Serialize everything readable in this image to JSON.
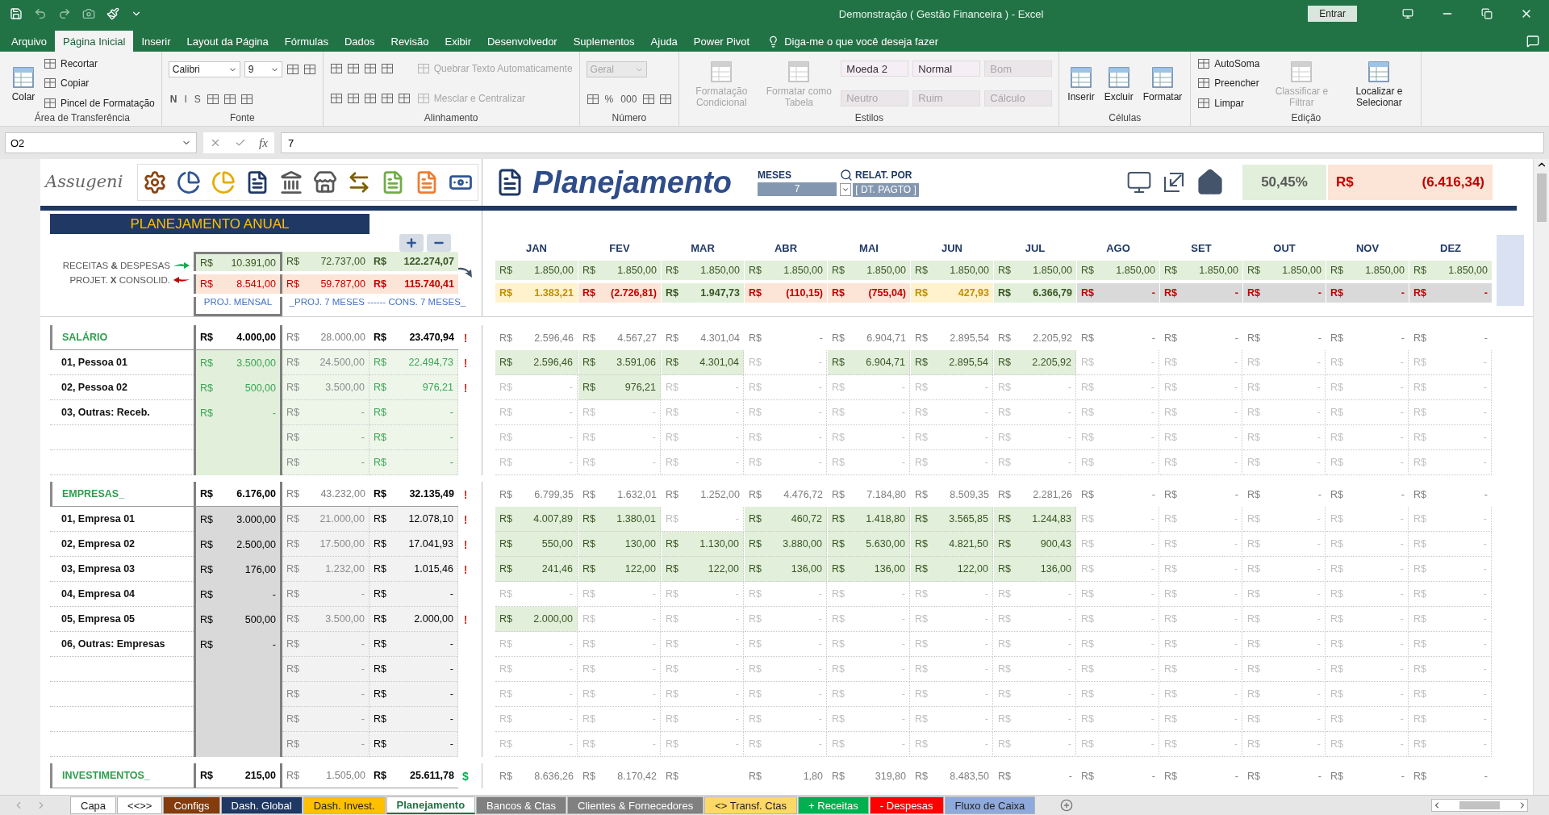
{
  "window": {
    "title": "Demonstração ( Gestão Financeira )  -  Excel",
    "sign_in": "Entrar"
  },
  "ribbon_tabs": [
    {
      "label": "Arquivo",
      "selected": false
    },
    {
      "label": "Página Inicial",
      "selected": true
    },
    {
      "label": "Inserir",
      "selected": false
    },
    {
      "label": "Layout da Página",
      "selected": false
    },
    {
      "label": "Fórmulas",
      "selected": false
    },
    {
      "label": "Dados",
      "selected": false
    },
    {
      "label": "Revisão",
      "selected": false
    },
    {
      "label": "Exibir",
      "selected": false
    },
    {
      "label": "Desenvolvedor",
      "selected": false
    },
    {
      "label": "Suplementos",
      "selected": false
    },
    {
      "label": "Ajuda",
      "selected": false
    },
    {
      "label": "Power Pivot",
      "selected": false
    }
  ],
  "tell_me": "Diga-me o que você deseja fazer",
  "ribbon": [
    {
      "label": "Área de Transferência",
      "columns": [
        [
          [
            {
              "kind": "big",
              "label": "Colar",
              "disabled": false
            }
          ]
        ],
        [
          [
            {
              "kind": "small",
              "label": "Recortar",
              "disabled": false
            }
          ],
          [
            {
              "kind": "small",
              "label": "Copiar",
              "disabled": false
            }
          ],
          [
            {
              "kind": "small",
              "label": "Pincel de Formatação",
              "disabled": false
            }
          ]
        ]
      ]
    },
    {
      "label": "Fonte",
      "columns": [
        [
          [
            {
              "kind": "field",
              "label": "Calibri",
              "disabled": false
            },
            {
              "kind": "field",
              "label": "9",
              "disabled": false
            },
            {
              "kind": "icon"
            },
            {
              "kind": "icon"
            }
          ],
          [
            {
              "kind": "glyph",
              "label": "N",
              "disabled": false
            },
            {
              "kind": "glyph",
              "label": "I",
              "disabled": false
            },
            {
              "kind": "glyph",
              "label": "S",
              "disabled": false
            },
            {
              "kind": "icon"
            },
            {
              "kind": "icon"
            },
            {
              "kind": "icon"
            }
          ]
        ]
      ]
    },
    {
      "label": "Alinhamento",
      "columns": [
        [
          [
            {
              "kind": "icon"
            },
            {
              "kind": "icon"
            },
            {
              "kind": "icon"
            },
            {
              "kind": "icon"
            }
          ],
          [
            {
              "kind": "icon"
            },
            {
              "kind": "icon"
            },
            {
              "kind": "icon"
            },
            {
              "kind": "icon"
            },
            {
              "kind": "icon"
            }
          ]
        ],
        [
          [
            {
              "kind": "small",
              "label": "Quebrar Texto Automaticamente",
              "disabled": true
            }
          ],
          [
            {
              "kind": "small",
              "label": "Mesclar e Centralizar",
              "disabled": true
            }
          ]
        ]
      ]
    },
    {
      "label": "Número",
      "columns": [
        [
          [
            {
              "kind": "field",
              "label": "Geral",
              "disabled": true
            }
          ],
          [
            {
              "kind": "icon"
            },
            {
              "kind": "glyph",
              "label": "%",
              "disabled": false
            },
            {
              "kind": "glyph",
              "label": "000",
              "disabled": false
            },
            {
              "kind": "icon"
            },
            {
              "kind": "icon"
            }
          ]
        ]
      ]
    },
    {
      "label": "Estilos",
      "columns": [
        [
          [
            {
              "kind": "big",
              "label": "Formatação Condicional",
              "disabled": true
            }
          ]
        ],
        [
          [
            {
              "kind": "big",
              "label": "Formatar como Tabela",
              "disabled": true
            }
          ]
        ],
        [
          [
            {
              "kind": "style",
              "label": "Moeda 2",
              "disabled": false
            },
            {
              "kind": "style",
              "label": "Normal",
              "disabled": false
            },
            {
              "kind": "style",
              "label": "Bom",
              "disabled": true
            }
          ],
          [
            {
              "kind": "style",
              "label": "Neutro",
              "disabled": true
            },
            {
              "kind": "style",
              "label": "Ruim",
              "disabled": true
            },
            {
              "kind": "style",
              "label": "Cálculo",
              "disabled": true
            }
          ]
        ]
      ]
    },
    {
      "label": "Células",
      "columns": [
        [
          [
            {
              "kind": "big",
              "label": "Inserir",
              "disabled": false
            }
          ]
        ],
        [
          [
            {
              "kind": "big",
              "label": "Excluir",
              "disabled": false
            }
          ]
        ],
        [
          [
            {
              "kind": "big",
              "label": "Formatar",
              "disabled": false
            }
          ]
        ]
      ]
    },
    {
      "label": "Edição",
      "columns": [
        [
          [
            {
              "kind": "small",
              "label": "AutoSoma",
              "disabled": false
            }
          ],
          [
            {
              "kind": "small",
              "label": "Preencher",
              "disabled": false
            }
          ],
          [
            {
              "kind": "small",
              "label": "Limpar",
              "disabled": false
            }
          ]
        ],
        [
          [
            {
              "kind": "big",
              "label": "Classificar e Filtrar",
              "disabled": true
            }
          ]
        ],
        [
          [
            {
              "kind": "big",
              "label": "Localizar e Selecionar",
              "disabled": false
            }
          ]
        ]
      ]
    }
  ],
  "formula_bar": {
    "name_box": "O2",
    "fx": "fx",
    "value": "7"
  },
  "sheet": {
    "logo": "Assugeni",
    "title": "Planejamento",
    "months_label": "MESES",
    "months_value": "7",
    "report_label": "RELAT. POR",
    "report_value": "[ DT. PAGTO ]",
    "ratio": "50,45%",
    "balance": [
      "R$",
      "(6.416,34)"
    ],
    "banner": "PLANEJAMENTO ANUAL",
    "legend": [
      "RECEITAS **&** DESPESAS",
      "PROJET. **X** CONSOLID."
    ],
    "months": [
      "JAN",
      "FEV",
      "MAR",
      "ABR",
      "MAI",
      "JUN",
      "JUL",
      "AGO",
      "SET",
      "OUT",
      "NOV",
      "DEZ"
    ],
    "summary": [
      {
        "kind": "income",
        "cells": [
          [
            "R$",
            "10.391,00"
          ],
          [
            "R$",
            "72.737,00"
          ],
          [
            "R$",
            "122.274,07"
          ]
        ],
        "months": [
          {
            "text": [
              "R$",
              "1.850,00"
            ],
            "color": "#e2efda"
          },
          {
            "text": [
              "R$",
              "1.850,00"
            ],
            "color": "#e2efda"
          },
          {
            "text": [
              "R$",
              "1.850,00"
            ],
            "color": "#e2efda"
          },
          {
            "text": [
              "R$",
              "1.850,00"
            ],
            "color": "#e2efda"
          },
          {
            "text": [
              "R$",
              "1.850,00"
            ],
            "color": "#e2efda"
          },
          {
            "text": [
              "R$",
              "1.850,00"
            ],
            "color": "#e2efda"
          },
          {
            "text": [
              "R$",
              "1.850,00"
            ],
            "color": "#e2efda"
          },
          {
            "text": [
              "R$",
              "1.850,00"
            ],
            "color": "#e2efda"
          },
          {
            "text": [
              "R$",
              "1.850,00"
            ],
            "color": "#e2efda"
          },
          {
            "text": [
              "R$",
              "1.850,00"
            ],
            "color": "#e2efda"
          },
          {
            "text": [
              "R$",
              "1.850,00"
            ],
            "color": "#e2efda"
          },
          {
            "text": [
              "R$",
              "1.850,00"
            ],
            "color": "#e2efda"
          }
        ]
      },
      {
        "kind": "expense",
        "cells": [
          [
            "R$",
            "8.541,00"
          ],
          [
            "R$",
            "59.787,00"
          ],
          [
            "R$",
            "115.740,41"
          ]
        ],
        "months": [
          {
            "text": [
              "R$",
              "1.383,21"
            ],
            "color": "#fff2cc"
          },
          {
            "text": [
              "R$",
              "(2.726,81)"
            ],
            "color": "#fce4d6"
          },
          {
            "text": [
              "R$",
              "1.947,73"
            ],
            "color": "#e2efda"
          },
          {
            "text": [
              "R$",
              "(110,15)"
            ],
            "color": "#fce4d6"
          },
          {
            "text": [
              "R$",
              "(755,04)"
            ],
            "color": "#fce4d6"
          },
          {
            "text": [
              "R$",
              "427,93"
            ],
            "color": "#fff2cc"
          },
          {
            "text": [
              "R$",
              "6.366,79"
            ],
            "color": "#e2efda"
          },
          {
            "text": [
              "R$",
              "-"
            ],
            "color": "#d9d9d9"
          },
          {
            "text": [
              "R$",
              "-"
            ],
            "color": "#d9d9d9"
          },
          {
            "text": [
              "R$",
              "-"
            ],
            "color": "#d9d9d9"
          },
          {
            "text": [
              "R$",
              "-"
            ],
            "color": "#d9d9d9"
          },
          {
            "text": [
              "R$",
              "-"
            ],
            "color": "#d9d9d9"
          }
        ]
      }
    ],
    "captions": [
      "PROJ. MENSAL",
      "_PROJ. 7 MESES  ------  CONS. 7 MESES_"
    ],
    "rows": [
      {
        "kind": "section",
        "label": "SALÁRIO",
        "cells": [
          [
            "R$",
            "4.000,00"
          ],
          [
            "R$",
            "28.000,00"
          ],
          [
            "R$",
            "23.470,94"
          ]
        ],
        "flag": {
          "text": "!",
          "color": "#c0392b"
        },
        "months": [
          [
            "R$",
            "2.596,46"
          ],
          [
            "R$",
            "4.567,27"
          ],
          [
            "R$",
            "4.301,04"
          ],
          [
            "R$",
            "-"
          ],
          [
            "R$",
            "6.904,71"
          ],
          [
            "R$",
            "2.895,54"
          ],
          [
            "R$",
            "2.205,92"
          ],
          [
            "R$",
            "-"
          ],
          [
            "R$",
            "-"
          ],
          [
            "R$",
            "-"
          ],
          [
            "R$",
            "-"
          ],
          [
            "R$",
            "-"
          ]
        ]
      },
      {
        "kind": "income",
        "label": "01,  Pessoa 01",
        "cells": [
          [
            "R$",
            "3.500,00"
          ],
          [
            "R$",
            "24.500,00"
          ],
          [
            "R$",
            "22.494,73"
          ]
        ],
        "flag": {
          "text": "!",
          "color": "#c0392b"
        },
        "months": [
          [
            "R$",
            "2.596,46"
          ],
          [
            "R$",
            "3.591,06"
          ],
          [
            "R$",
            "4.301,04"
          ],
          [
            "R$",
            "-"
          ],
          [
            "R$",
            "6.904,71"
          ],
          [
            "R$",
            "2.895,54"
          ],
          [
            "R$",
            "2.205,92"
          ],
          [
            "R$",
            "-"
          ],
          [
            "R$",
            "-"
          ],
          [
            "R$",
            "-"
          ],
          [
            "R$",
            "-"
          ],
          [
            "R$",
            "-"
          ]
        ],
        "hl": [
          true,
          true,
          true,
          false,
          true,
          true,
          true,
          false,
          false,
          false,
          false,
          false
        ]
      },
      {
        "kind": "income",
        "label": "02,  Pessoa 02",
        "cells": [
          [
            "R$",
            "500,00"
          ],
          [
            "R$",
            "3.500,00"
          ],
          [
            "R$",
            "976,21"
          ]
        ],
        "flag": {
          "text": "!",
          "color": "#c0392b"
        },
        "months": [
          [
            "R$",
            "-"
          ],
          [
            "R$",
            "976,21"
          ],
          [
            "R$",
            "-"
          ],
          [
            "R$",
            "-"
          ],
          [
            "R$",
            "-"
          ],
          [
            "R$",
            "-"
          ],
          [
            "R$",
            "-"
          ],
          [
            "R$",
            "-"
          ],
          [
            "R$",
            "-"
          ],
          [
            "R$",
            "-"
          ],
          [
            "R$",
            "-"
          ],
          [
            "R$",
            "-"
          ]
        ],
        "hl": [
          false,
          true,
          false,
          false,
          false,
          false,
          false,
          false,
          false,
          false,
          false,
          false
        ]
      },
      {
        "kind": "income",
        "label": "03,  Outras: Receb.",
        "cells": [
          [
            "R$",
            "-"
          ],
          [
            "R$",
            "-"
          ],
          [
            "R$",
            "-"
          ]
        ],
        "months": [
          [
            "R$",
            "-"
          ],
          [
            "R$",
            "-"
          ],
          [
            "R$",
            "-"
          ],
          [
            "R$",
            "-"
          ],
          [
            "R$",
            "-"
          ],
          [
            "R$",
            "-"
          ],
          [
            "R$",
            "-"
          ],
          [
            "R$",
            "-"
          ],
          [
            "R$",
            "-"
          ],
          [
            "R$",
            "-"
          ],
          [
            "R$",
            "-"
          ],
          [
            "R$",
            "-"
          ]
        ],
        "hl": [
          false,
          false,
          false,
          false,
          false,
          false,
          false,
          false,
          false,
          false,
          false,
          false
        ]
      },
      {
        "kind": "income",
        "cells": [
          null,
          [
            "R$",
            "-"
          ],
          [
            "R$",
            "-"
          ]
        ],
        "months": [
          [
            "R$",
            "-"
          ],
          [
            "R$",
            "-"
          ],
          [
            "R$",
            "-"
          ],
          [
            "R$",
            "-"
          ],
          [
            "R$",
            "-"
          ],
          [
            "R$",
            "-"
          ],
          [
            "R$",
            "-"
          ],
          [
            "R$",
            "-"
          ],
          [
            "R$",
            "-"
          ],
          [
            "R$",
            "-"
          ],
          [
            "R$",
            "-"
          ],
          [
            "R$",
            "-"
          ]
        ],
        "hl": [
          false,
          false,
          false,
          false,
          false,
          false,
          false,
          false,
          false,
          false,
          false,
          false
        ]
      },
      {
        "kind": "income",
        "cells": [
          null,
          [
            "R$",
            "-"
          ],
          [
            "R$",
            "-"
          ]
        ],
        "months": [
          [
            "R$",
            "-"
          ],
          [
            "R$",
            "-"
          ],
          [
            "R$",
            "-"
          ],
          [
            "R$",
            "-"
          ],
          [
            "R$",
            "-"
          ],
          [
            "R$",
            "-"
          ],
          [
            "R$",
            "-"
          ],
          [
            "R$",
            "-"
          ],
          [
            "R$",
            "-"
          ],
          [
            "R$",
            "-"
          ],
          [
            "R$",
            "-"
          ],
          [
            "R$",
            "-"
          ]
        ],
        "hl": [
          false,
          false,
          false,
          false,
          false,
          false,
          false,
          false,
          false,
          false,
          false,
          false
        ]
      },
      {
        "kind": "section",
        "label": "EMPRESAS_",
        "cells": [
          [
            "R$",
            "6.176,00"
          ],
          [
            "R$",
            "43.232,00"
          ],
          [
            "R$",
            "32.135,49"
          ]
        ],
        "flag": {
          "text": "!",
          "color": "#c0392b"
        },
        "months": [
          [
            "R$",
            "6.799,35"
          ],
          [
            "R$",
            "1.632,01"
          ],
          [
            "R$",
            "1.252,00"
          ],
          [
            "R$",
            "4.476,72"
          ],
          [
            "R$",
            "7.184,80"
          ],
          [
            "R$",
            "8.509,35"
          ],
          [
            "R$",
            "2.281,26"
          ],
          [
            "R$",
            "-"
          ],
          [
            "R$",
            "-"
          ],
          [
            "R$",
            "-"
          ],
          [
            "R$",
            "-"
          ],
          [
            "R$",
            "-"
          ]
        ]
      },
      {
        "kind": "expense",
        "label": "01,  Empresa 01",
        "cells": [
          [
            "R$",
            "3.000,00"
          ],
          [
            "R$",
            "21.000,00"
          ],
          [
            "R$",
            "12.078,10"
          ]
        ],
        "flag": {
          "text": "!",
          "color": "#c0392b"
        },
        "months": [
          [
            "R$",
            "4.007,89"
          ],
          [
            "R$",
            "1.380,01"
          ],
          [
            "R$",
            "-"
          ],
          [
            "R$",
            "460,72"
          ],
          [
            "R$",
            "1.418,80"
          ],
          [
            "R$",
            "3.565,85"
          ],
          [
            "R$",
            "1.244,83"
          ],
          [
            "R$",
            "-"
          ],
          [
            "R$",
            "-"
          ],
          [
            "R$",
            "-"
          ],
          [
            "R$",
            "-"
          ],
          [
            "R$",
            "-"
          ]
        ],
        "hl": [
          true,
          true,
          false,
          true,
          true,
          true,
          true,
          false,
          false,
          false,
          false,
          false
        ]
      },
      {
        "kind": "expense",
        "label": "02,  Empresa 02",
        "cells": [
          [
            "R$",
            "2.500,00"
          ],
          [
            "R$",
            "17.500,00"
          ],
          [
            "R$",
            "17.041,93"
          ]
        ],
        "flag": {
          "text": "!",
          "color": "#c0392b"
        },
        "months": [
          [
            "R$",
            "550,00"
          ],
          [
            "R$",
            "130,00"
          ],
          [
            "R$",
            "1.130,00"
          ],
          [
            "R$",
            "3.880,00"
          ],
          [
            "R$",
            "5.630,00"
          ],
          [
            "R$",
            "4.821,50"
          ],
          [
            "R$",
            "900,43"
          ],
          [
            "R$",
            "-"
          ],
          [
            "R$",
            "-"
          ],
          [
            "R$",
            "-"
          ],
          [
            "R$",
            "-"
          ],
          [
            "R$",
            "-"
          ]
        ],
        "hl": [
          true,
          true,
          true,
          true,
          true,
          true,
          true,
          false,
          false,
          false,
          false,
          false
        ]
      },
      {
        "kind": "expense",
        "label": "03,  Empresa 03",
        "cells": [
          [
            "R$",
            "176,00"
          ],
          [
            "R$",
            "1.232,00"
          ],
          [
            "R$",
            "1.015,46"
          ]
        ],
        "flag": {
          "text": "!",
          "color": "#c0392b"
        },
        "months": [
          [
            "R$",
            "241,46"
          ],
          [
            "R$",
            "122,00"
          ],
          [
            "R$",
            "122,00"
          ],
          [
            "R$",
            "136,00"
          ],
          [
            "R$",
            "136,00"
          ],
          [
            "R$",
            "122,00"
          ],
          [
            "R$",
            "136,00"
          ],
          [
            "R$",
            "-"
          ],
          [
            "R$",
            "-"
          ],
          [
            "R$",
            "-"
          ],
          [
            "R$",
            "-"
          ],
          [
            "R$",
            "-"
          ]
        ],
        "hl": [
          true,
          true,
          true,
          true,
          true,
          true,
          true,
          false,
          false,
          false,
          false,
          false
        ]
      },
      {
        "kind": "expense",
        "label": "04,  Empresa 04",
        "cells": [
          [
            "R$",
            "-"
          ],
          [
            "R$",
            "-"
          ],
          [
            "R$",
            "-"
          ]
        ],
        "months": [
          [
            "R$",
            "-"
          ],
          [
            "R$",
            "-"
          ],
          [
            "R$",
            "-"
          ],
          [
            "R$",
            "-"
          ],
          [
            "R$",
            "-"
          ],
          [
            "R$",
            "-"
          ],
          [
            "R$",
            "-"
          ],
          [
            "R$",
            "-"
          ],
          [
            "R$",
            "-"
          ],
          [
            "R$",
            "-"
          ],
          [
            "R$",
            "-"
          ],
          [
            "R$",
            "-"
          ]
        ],
        "hl": [
          false,
          false,
          false,
          false,
          false,
          false,
          false,
          false,
          false,
          false,
          false,
          false
        ]
      },
      {
        "kind": "expense",
        "label": "05,  Empresa 05",
        "cells": [
          [
            "R$",
            "500,00"
          ],
          [
            "R$",
            "3.500,00"
          ],
          [
            "R$",
            "2.000,00"
          ]
        ],
        "flag": {
          "text": "!",
          "color": "#c0392b"
        },
        "months": [
          [
            "R$",
            "2.000,00"
          ],
          [
            "R$",
            "-"
          ],
          [
            "R$",
            "-"
          ],
          [
            "R$",
            "-"
          ],
          [
            "R$",
            "-"
          ],
          [
            "R$",
            "-"
          ],
          [
            "R$",
            "-"
          ],
          [
            "R$",
            "-"
          ],
          [
            "R$",
            "-"
          ],
          [
            "R$",
            "-"
          ],
          [
            "R$",
            "-"
          ],
          [
            "R$",
            "-"
          ]
        ],
        "hl": [
          true,
          false,
          false,
          false,
          false,
          false,
          false,
          false,
          false,
          false,
          false,
          false
        ]
      },
      {
        "kind": "expense",
        "label": "06,  Outras: Empresas",
        "cells": [
          [
            "R$",
            "-"
          ],
          [
            "R$",
            "-"
          ],
          [
            "R$",
            "-"
          ]
        ],
        "months": [
          [
            "R$",
            "-"
          ],
          [
            "R$",
            "-"
          ],
          [
            "R$",
            "-"
          ],
          [
            "R$",
            "-"
          ],
          [
            "R$",
            "-"
          ],
          [
            "R$",
            "-"
          ],
          [
            "R$",
            "-"
          ],
          [
            "R$",
            "-"
          ],
          [
            "R$",
            "-"
          ],
          [
            "R$",
            "-"
          ],
          [
            "R$",
            "-"
          ],
          [
            "R$",
            "-"
          ]
        ],
        "hl": [
          false,
          false,
          false,
          false,
          false,
          false,
          false,
          false,
          false,
          false,
          false,
          false
        ]
      },
      {
        "kind": "expense",
        "cells": [
          null,
          [
            "R$",
            "-"
          ],
          [
            "R$",
            "-"
          ]
        ],
        "months": [
          [
            "R$",
            "-"
          ],
          [
            "R$",
            "-"
          ],
          [
            "R$",
            "-"
          ],
          [
            "R$",
            "-"
          ],
          [
            "R$",
            "-"
          ],
          [
            "R$",
            "-"
          ],
          [
            "R$",
            "-"
          ],
          [
            "R$",
            "-"
          ],
          [
            "R$",
            "-"
          ],
          [
            "R$",
            "-"
          ],
          [
            "R$",
            "-"
          ],
          [
            "R$",
            "-"
          ]
        ],
        "hl": [
          false,
          false,
          false,
          false,
          false,
          false,
          false,
          false,
          false,
          false,
          false,
          false
        ]
      },
      {
        "kind": "expense",
        "cells": [
          null,
          [
            "R$",
            "-"
          ],
          [
            "R$",
            "-"
          ]
        ],
        "months": [
          [
            "R$",
            "-"
          ],
          [
            "R$",
            "-"
          ],
          [
            "R$",
            "-"
          ],
          [
            "R$",
            "-"
          ],
          [
            "R$",
            "-"
          ],
          [
            "R$",
            "-"
          ],
          [
            "R$",
            "-"
          ],
          [
            "R$",
            "-"
          ],
          [
            "R$",
            "-"
          ],
          [
            "R$",
            "-"
          ],
          [
            "R$",
            "-"
          ],
          [
            "R$",
            "-"
          ]
        ],
        "hl": [
          false,
          false,
          false,
          false,
          false,
          false,
          false,
          false,
          false,
          false,
          false,
          false
        ]
      },
      {
        "kind": "expense",
        "cells": [
          null,
          [
            "R$",
            "-"
          ],
          [
            "R$",
            "-"
          ]
        ],
        "months": [
          [
            "R$",
            "-"
          ],
          [
            "R$",
            "-"
          ],
          [
            "R$",
            "-"
          ],
          [
            "R$",
            "-"
          ],
          [
            "R$",
            "-"
          ],
          [
            "R$",
            "-"
          ],
          [
            "R$",
            "-"
          ],
          [
            "R$",
            "-"
          ],
          [
            "R$",
            "-"
          ],
          [
            "R$",
            "-"
          ],
          [
            "R$",
            "-"
          ],
          [
            "R$",
            "-"
          ]
        ],
        "hl": [
          false,
          false,
          false,
          false,
          false,
          false,
          false,
          false,
          false,
          false,
          false,
          false
        ]
      },
      {
        "kind": "expense",
        "cells": [
          null,
          [
            "R$",
            "-"
          ],
          [
            "R$",
            "-"
          ]
        ],
        "months": [
          [
            "R$",
            "-"
          ],
          [
            "R$",
            "-"
          ],
          [
            "R$",
            "-"
          ],
          [
            "R$",
            "-"
          ],
          [
            "R$",
            "-"
          ],
          [
            "R$",
            "-"
          ],
          [
            "R$",
            "-"
          ],
          [
            "R$",
            "-"
          ],
          [
            "R$",
            "-"
          ],
          [
            "R$",
            "-"
          ],
          [
            "R$",
            "-"
          ],
          [
            "R$",
            "-"
          ]
        ],
        "hl": [
          false,
          false,
          false,
          false,
          false,
          false,
          false,
          false,
          false,
          false,
          false,
          false
        ]
      },
      {
        "kind": "section",
        "label": "INVESTIMENTOS_",
        "cells": [
          [
            "R$",
            "215,00"
          ],
          [
            "R$",
            "1.505,00"
          ],
          [
            "R$",
            "25.611,78"
          ]
        ],
        "flag": {
          "text": "$",
          "color": "#00b050"
        },
        "months": [
          [
            "R$",
            "8.636,26"
          ],
          [
            "R$",
            "8.170,42"
          ],
          [
            "R$"
          ],
          [
            "R$",
            "1,80"
          ],
          [
            "R$",
            "319,80"
          ],
          [
            "R$",
            "8.483,50"
          ],
          [
            "R$",
            "-"
          ],
          [
            "R$",
            "-"
          ],
          [
            "R$",
            "-"
          ],
          [
            "R$",
            "-"
          ],
          [
            "R$",
            "-"
          ],
          [
            "R$",
            "-"
          ]
        ]
      }
    ]
  },
  "sheet_tabs": [
    {
      "label": "Capa",
      "selected": false
    },
    {
      "label": "<<>>",
      "selected": false
    },
    {
      "label": "Configs",
      "selected": false,
      "color": "#843c0c"
    },
    {
      "label": "Dash. Global",
      "selected": false,
      "color": "#1f3864"
    },
    {
      "label": "Dash. Invest.",
      "selected": false,
      "color": "#ffc000"
    },
    {
      "label": "Planejamento",
      "selected": true
    },
    {
      "label": "Bancos & Ctas",
      "selected": false,
      "color": "#808080"
    },
    {
      "label": "Clientes & Fornecedores",
      "selected": false,
      "color": "#808080"
    },
    {
      "label": "<> Transf. Ctas",
      "selected": false,
      "color": "#ffd966"
    },
    {
      "label": "+ Receitas",
      "selected": false,
      "color": "#00b050"
    },
    {
      "label": "- Despesas",
      "selected": false,
      "color": "#ff0000"
    },
    {
      "label": "Fluxo de Caixa",
      "selected": false,
      "color": "#8ea9db"
    }
  ]
}
